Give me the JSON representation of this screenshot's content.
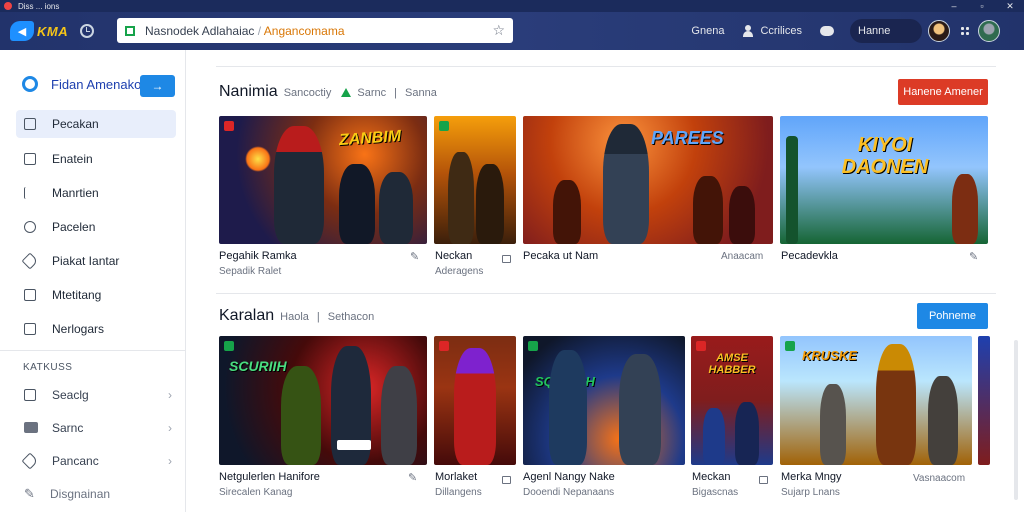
{
  "window": {
    "title": "Diss ... ions"
  },
  "toolbar": {
    "logo_text": "KMA",
    "url_main": "Nasnodek Adlahaiac",
    "url_accent": "Angancomama",
    "link_one": "Gnena",
    "link_two": "Ccrilices",
    "user_name": "Hanne"
  },
  "sidebar": {
    "header_label": "Fidan Amenakon",
    "header_button": "→",
    "items": [
      {
        "label": "Pecakan",
        "icon": "info-icon",
        "active": true
      },
      {
        "label": "Enatein",
        "icon": "square-icon"
      },
      {
        "label": "Manrtien",
        "icon": "bar-icon"
      },
      {
        "label": "Pacelen",
        "icon": "circle-icon"
      },
      {
        "label": "Piakat Iantar",
        "icon": "tag-icon"
      },
      {
        "label": "Mtetitang",
        "icon": "square-icon"
      },
      {
        "label": "Nerlogars",
        "icon": "grid-icon"
      }
    ],
    "section_label": "KATKUSS",
    "group_items": [
      {
        "label": "Seaclg",
        "icon": "square-icon"
      },
      {
        "label": "Sarnc",
        "icon": "folder-icon"
      },
      {
        "label": "Pancanc",
        "icon": "tag-icon"
      },
      {
        "label": "Disgnainan",
        "icon": "pen-icon"
      }
    ]
  },
  "section1": {
    "title": "Nanimia",
    "subtitle": "Sancoctiy",
    "tag": "Sarnc",
    "tag2": "Sanna",
    "cta": "Hanene Amener",
    "cards": [
      {
        "logo": "ZANBIM",
        "title": "Pegahik Ramka",
        "sub": "Sepadik Ralet"
      },
      {
        "logo": "",
        "title": "Neckan",
        "sub": "Aderagens"
      },
      {
        "logo": "PAREES",
        "title": "Pecaka ut Nam",
        "sub": ""
      },
      {
        "logo": "KIYOI DAONEN",
        "title": "Pecadevkla",
        "sub": ""
      }
    ],
    "card3_meta": "Anaacam"
  },
  "section2": {
    "title": "Karalan",
    "subtitle": "Haola",
    "tag": "Sethacon",
    "cta": "Pohneme",
    "cards": [
      {
        "logo": "SCURIIH",
        "title": "Netgulerlen Hanifore",
        "sub": "Sirecalen Kanag"
      },
      {
        "logo": "",
        "title": "Morlaket",
        "sub": "Dillangens"
      },
      {
        "logo": "SQNRICH",
        "title": "Agenl Nangy Nake",
        "sub": "Dooendi Nepanaans"
      },
      {
        "logo": "AMSE HABBER",
        "title": "Meckan",
        "sub": "Bigascnas"
      },
      {
        "logo": "KRUSKE",
        "title": "Merka Mngy",
        "sub": "Sujarp Lnans"
      }
    ],
    "card5_meta": "Vasnaacom"
  },
  "colors": {
    "accent_red": "#dc3b26",
    "accent_blue": "#1e88e5",
    "nav_bg": "#22336b"
  }
}
